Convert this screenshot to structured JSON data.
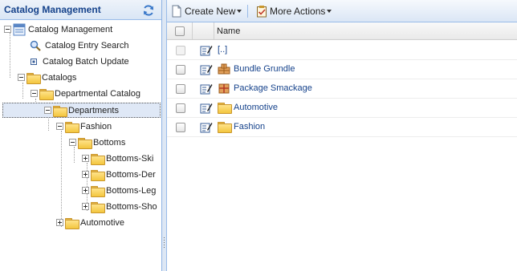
{
  "left_panel": {
    "title": "Catalog Management",
    "refresh_icon": "refresh-icon",
    "tree": {
      "root": "Catalog Management",
      "entry_search": "Catalog Entry Search",
      "batch_update": "Catalog Batch Update",
      "catalogs": "Catalogs",
      "departmental_catalog": "Departmental Catalog",
      "departments": "Departments",
      "fashion": "Fashion",
      "bottoms": "Bottoms",
      "bottoms_children": [
        "Bottoms-Ski",
        "Bottoms-Der",
        "Bottoms-Leg",
        "Bottoms-Sho"
      ],
      "automotive": "Automotive"
    }
  },
  "toolbar": {
    "create_new": "Create New",
    "more_actions": "More Actions"
  },
  "grid": {
    "columns": {
      "name": "Name"
    },
    "rows": [
      {
        "name": "[..]",
        "type": "up"
      },
      {
        "name": "Bundle Grundle",
        "type": "bundle-icon"
      },
      {
        "name": "Package Smackage",
        "type": "package-icon"
      },
      {
        "name": "Automotive",
        "type": "folder-icon"
      },
      {
        "name": "Fashion",
        "type": "folder-icon"
      }
    ]
  },
  "colors": {
    "header_text": "#15428b",
    "border_blue": "#99bbe8",
    "link_text": "#15428b"
  }
}
